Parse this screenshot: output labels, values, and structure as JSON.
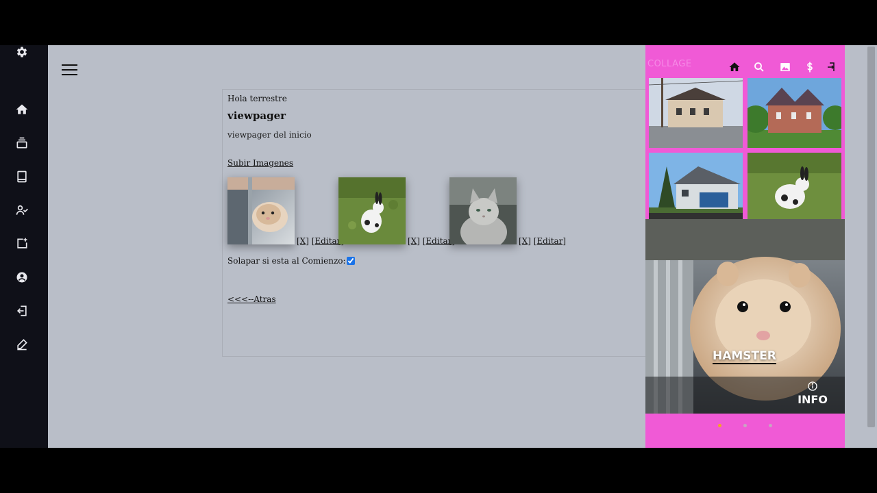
{
  "sidebar": {
    "items": [
      {
        "name": "settings",
        "icon": "gear-icon"
      },
      {
        "name": "home",
        "icon": "home-icon"
      },
      {
        "name": "layers",
        "icon": "layers-icon"
      },
      {
        "name": "book",
        "icon": "book-icon"
      },
      {
        "name": "user-check",
        "icon": "user-check-icon"
      },
      {
        "name": "add-box",
        "icon": "add-box-icon"
      },
      {
        "name": "account",
        "icon": "account-circle-icon"
      },
      {
        "name": "logout",
        "icon": "logout-icon"
      },
      {
        "name": "edit",
        "icon": "pencil-icon"
      }
    ]
  },
  "panel": {
    "greeting": "Hola terrestre",
    "title": "viewpager",
    "subtitle": "viewpager del inicio",
    "upload_link": "Subir Imagenes",
    "thumbnails": [
      {
        "subject": "hamster",
        "delete_label": "[X]",
        "edit_label": "[Editar]"
      },
      {
        "subject": "rabbit",
        "delete_label": "[X]",
        "edit_label": "[Editar]"
      },
      {
        "subject": "cat",
        "delete_label": "[X]",
        "edit_label": "[Editar]"
      }
    ],
    "overlap_label": "Solapar si esta al Comienzo:",
    "overlap_checked": true,
    "back_link": "<<<--Atras"
  },
  "phone": {
    "app_title": "COLLAGE",
    "toolbar_icons": [
      "home-icon",
      "search-icon",
      "image-icon",
      "dollar-icon",
      "exit-icon"
    ],
    "hero_label": "HAMSTER",
    "info_label": "INFO",
    "page_dots": 3,
    "active_dot": 0,
    "colors": {
      "background": "#f05ad6",
      "active_dot": "#f5a623",
      "inactive_dot": "#c9a4c2"
    }
  }
}
